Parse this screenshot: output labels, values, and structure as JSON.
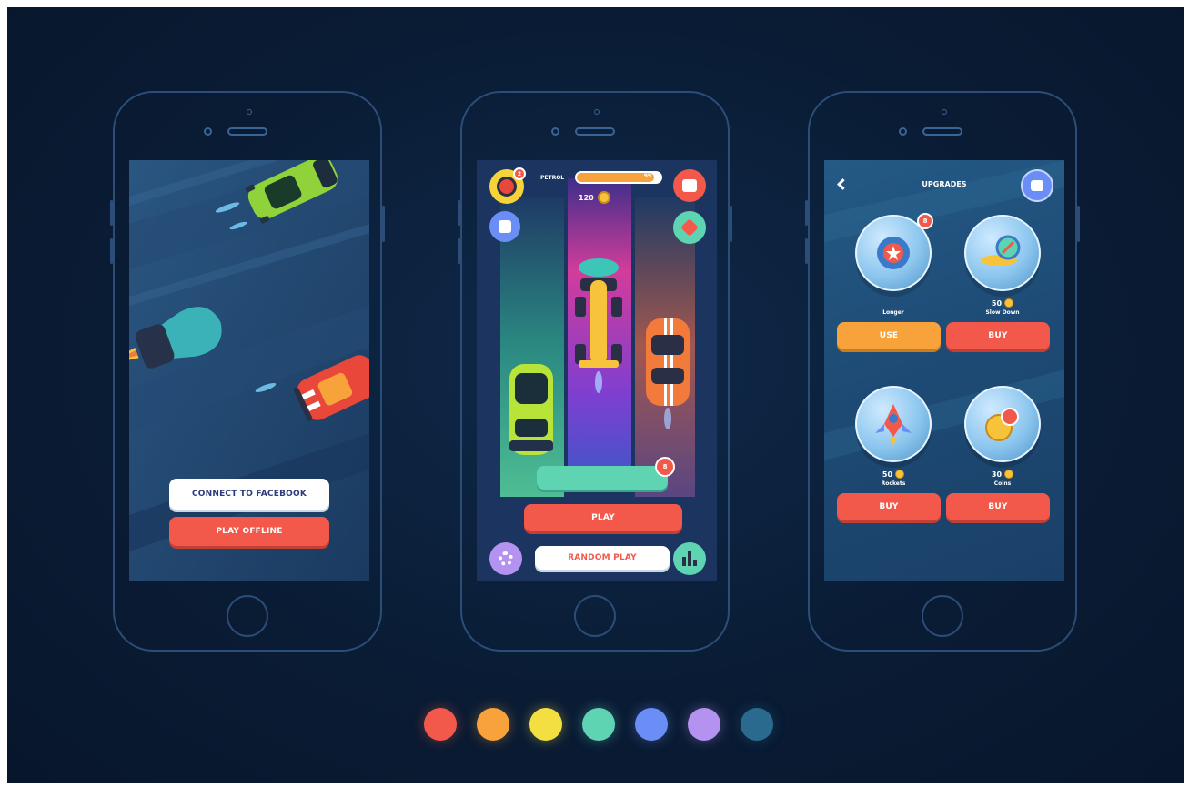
{
  "screens": {
    "login": {
      "connect_label": "CONNECT TO FACEBOOK",
      "offline_label": "PLAY OFFLINE"
    },
    "game": {
      "petrol_label": "PETROL",
      "petrol_value": "99 L",
      "petrol_level_percent": 92,
      "coins": "120",
      "avatar_badge": "2",
      "mystery_button_label": "",
      "mystery_badge": "8",
      "play_label": "PLAY",
      "random_play_label": "RANDOM PLAY"
    },
    "upgrades": {
      "title": "UPGRADES",
      "items": [
        {
          "name": "Longer",
          "price": "",
          "badge": "8",
          "action": "USE",
          "icon": "shield-icon"
        },
        {
          "name": "Slow Down",
          "price": "50",
          "badge": "",
          "action": "BUY",
          "icon": "snail-icon"
        },
        {
          "name": "Rockets",
          "price": "50",
          "badge": "",
          "action": "BUY",
          "icon": "rocket-icon"
        },
        {
          "name": "Coins",
          "price": "30",
          "badge": "",
          "action": "BUY",
          "icon": "coins-icon"
        }
      ]
    }
  },
  "palette": [
    "#f2594b",
    "#f7a23a",
    "#f3df3f",
    "#5fd4b3",
    "#6a8ef5",
    "#b392f0",
    "#2a6a8f"
  ],
  "colors": {
    "background": "#0a1c35",
    "accent_red": "#f2594b",
    "accent_yellow": "#f7a23a",
    "accent_teal": "#5fd4b3"
  }
}
